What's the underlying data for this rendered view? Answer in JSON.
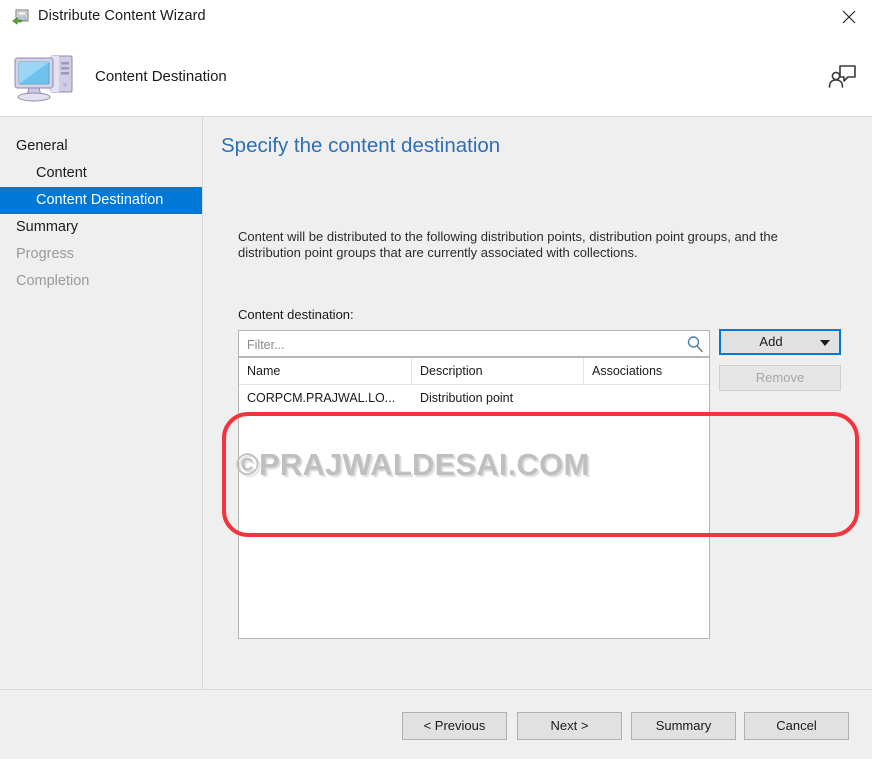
{
  "window": {
    "title": "Distribute Content Wizard",
    "title_icon": "distribute-content-icon",
    "close_icon": "close-icon"
  },
  "header": {
    "title": "Content Destination",
    "icon": "computer-icon",
    "help_icon": "person-feedback-icon"
  },
  "sidebar": {
    "items": [
      {
        "label": "General",
        "indent": false,
        "state": "done"
      },
      {
        "label": "Content",
        "indent": true,
        "state": "done"
      },
      {
        "label": "Content Destination",
        "indent": true,
        "state": "selected"
      },
      {
        "label": "Summary",
        "indent": false,
        "state": "done"
      },
      {
        "label": "Progress",
        "indent": false,
        "state": "disabled"
      },
      {
        "label": "Completion",
        "indent": false,
        "state": "disabled"
      }
    ],
    "selected_color": "#0078d7"
  },
  "main": {
    "heading": "Specify the content destination",
    "heading_color": "#2f6fb5",
    "description": "Content will be distributed to the following distribution points, distribution point groups, and the distribution point groups that are currently associated with collections.",
    "destination_label": "Content destination:",
    "filter": {
      "value": "",
      "placeholder": "Filter...",
      "search_icon": "search-icon"
    },
    "add_button": {
      "label": "Add",
      "caret_icon": "chevron-down-icon",
      "focused": true
    },
    "remove_button": {
      "label": "Remove",
      "enabled": false
    },
    "table": {
      "columns": [
        "Name",
        "Description",
        "Associations"
      ],
      "rows": [
        {
          "name": "CORPCM.PRAJWAL.LO...",
          "description": "Distribution point",
          "associations": ""
        }
      ]
    },
    "watermark": "©PRAJWALDESAI.COM",
    "highlight_color": "#f5333f"
  },
  "footer": {
    "buttons": [
      {
        "label": "< Previous"
      },
      {
        "label": "Next >"
      },
      {
        "label": "Summary"
      },
      {
        "label": "Cancel"
      }
    ]
  }
}
